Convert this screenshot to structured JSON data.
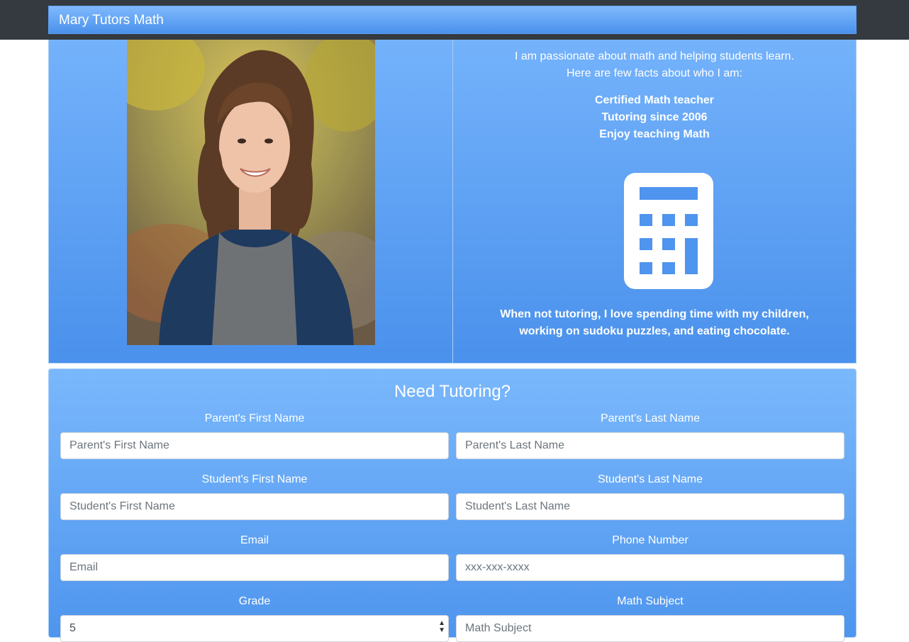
{
  "navbar": {
    "brand": "Mary Tutors Math"
  },
  "about": {
    "photo_icon": "portrait-photo",
    "intro_line1": "I am passionate about math and helping students learn.",
    "intro_line2": "Here are few facts about who I am:",
    "facts": [
      "Certified Math teacher",
      "Tutoring since 2006",
      "Enjoy teaching Math"
    ],
    "calculator_icon": "calculator-icon",
    "hobby_line1": "When not tutoring, I love spending time with my children,",
    "hobby_line2": "working on sudoku puzzles, and eating chocolate."
  },
  "form": {
    "title": "Need Tutoring?",
    "parent_first": {
      "label": "Parent's First Name",
      "placeholder": "Parent's First Name",
      "value": ""
    },
    "parent_last": {
      "label": "Parent's Last Name",
      "placeholder": "Parent's Last Name",
      "value": ""
    },
    "student_first": {
      "label": "Student's First Name",
      "placeholder": "Student's First Name",
      "value": ""
    },
    "student_last": {
      "label": "Student's Last Name",
      "placeholder": "Student's Last Name",
      "value": ""
    },
    "email": {
      "label": "Email",
      "placeholder": "Email",
      "value": ""
    },
    "phone": {
      "label": "Phone Number",
      "placeholder": "xxx-xxx-xxxx",
      "value": ""
    },
    "grade": {
      "label": "Grade",
      "selected": "5"
    },
    "subject": {
      "label": "Math Subject",
      "placeholder": "Math Subject",
      "value": ""
    }
  },
  "colors": {
    "navbar_bg": "#343a40",
    "panel_gradient_top": "#74b2fb",
    "panel_gradient_bottom": "#4a91ec",
    "text": "#ffffff"
  }
}
